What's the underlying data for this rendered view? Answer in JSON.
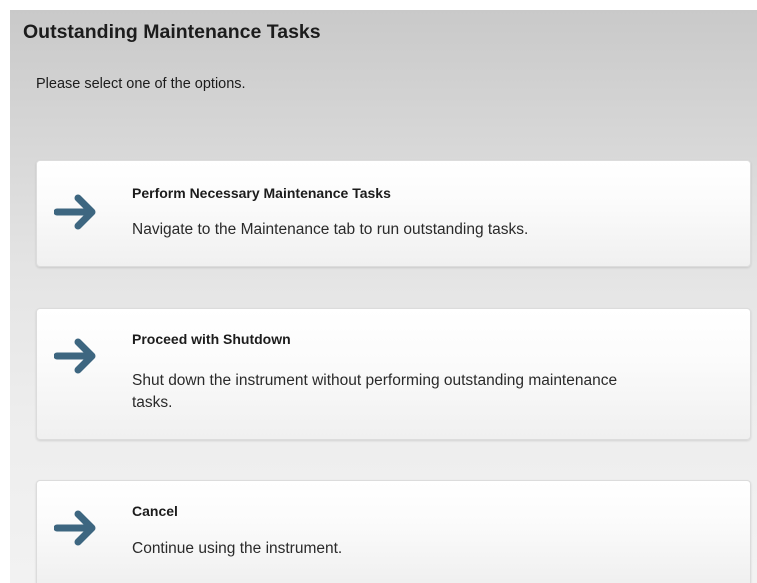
{
  "dialog": {
    "title": "Outstanding Maintenance Tasks",
    "subtitle": "Please select one of the options."
  },
  "options": [
    {
      "label": "Perform Necessary Maintenance Tasks",
      "description": "Navigate to the Maintenance tab to run outstanding tasks.",
      "icon": "arrow-right-icon"
    },
    {
      "label": "Proceed with Shutdown",
      "description": "Shut down the instrument without performing outstanding maintenance tasks.",
      "icon": "arrow-right-icon"
    },
    {
      "label": "Cancel",
      "description": "Continue using the instrument.",
      "icon": "arrow-right-icon"
    }
  ],
  "colors": {
    "arrow": "#3d6680",
    "title_text": "#1c1c1c",
    "card_border": "#dcdcdc"
  }
}
